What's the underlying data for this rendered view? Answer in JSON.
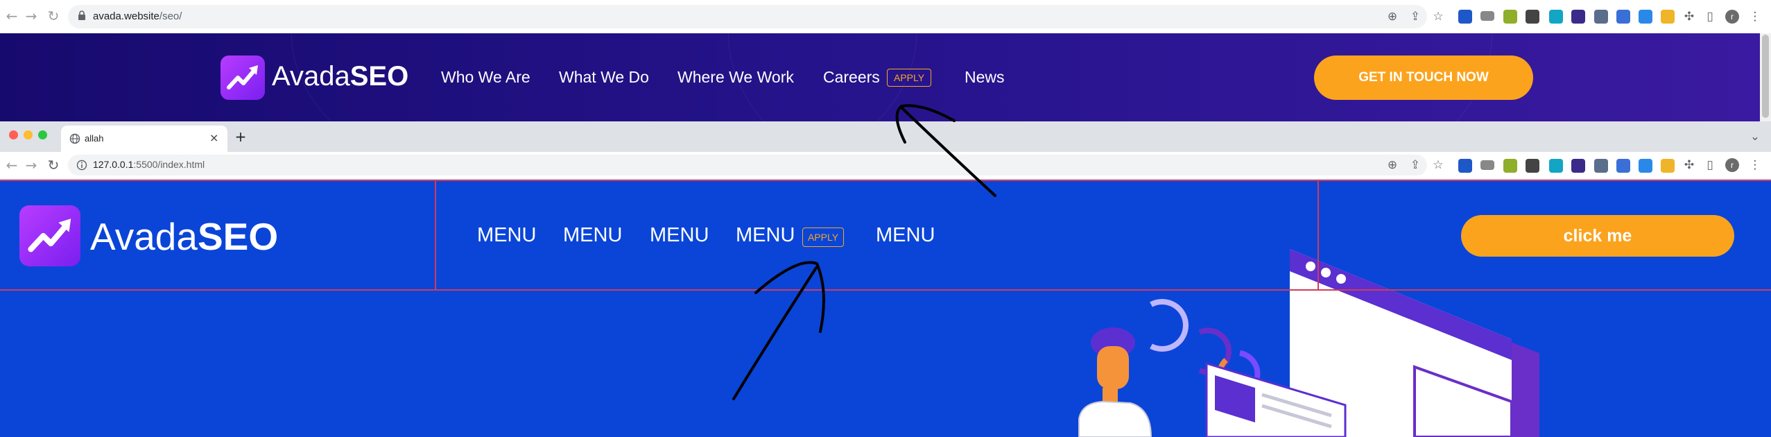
{
  "top_browser": {
    "url_host": "avada.website",
    "url_path": "/seo/"
  },
  "site1": {
    "logo_regular": "Avada",
    "logo_bold": "SEO",
    "nav": [
      "Who We Are",
      "What We Do",
      "Where We Work",
      "Careers",
      "News"
    ],
    "badge": "APPLY",
    "cta": "GET IN TOUCH NOW"
  },
  "second_browser": {
    "tab_title": "allah",
    "url_host": "127.0.0.1",
    "url_path": ":5500/index.html"
  },
  "site2": {
    "logo_regular": "Avada",
    "logo_bold": "SEO",
    "menus": [
      "MENU",
      "MENU",
      "MENU",
      "MENU",
      "MENU"
    ],
    "badge": "APPLY",
    "cta": "click me"
  },
  "colors": {
    "site1_bg": "#24138a",
    "site2_bg": "#0a45d8",
    "cta_orange": "#fba31d",
    "badge_orange": "#f5a623",
    "logo_purple": "#9b2cf6"
  },
  "icons": [
    "back-icon",
    "forward-icon",
    "reload-icon",
    "lock-icon",
    "zoom-icon",
    "share-icon",
    "star-icon",
    "puzzle-icon",
    "sidepanel-icon",
    "kebab-icon",
    "close-icon",
    "plus-icon",
    "chevron-down-icon",
    "info-icon",
    "globe-icon",
    "arrow-annotation-icon"
  ]
}
